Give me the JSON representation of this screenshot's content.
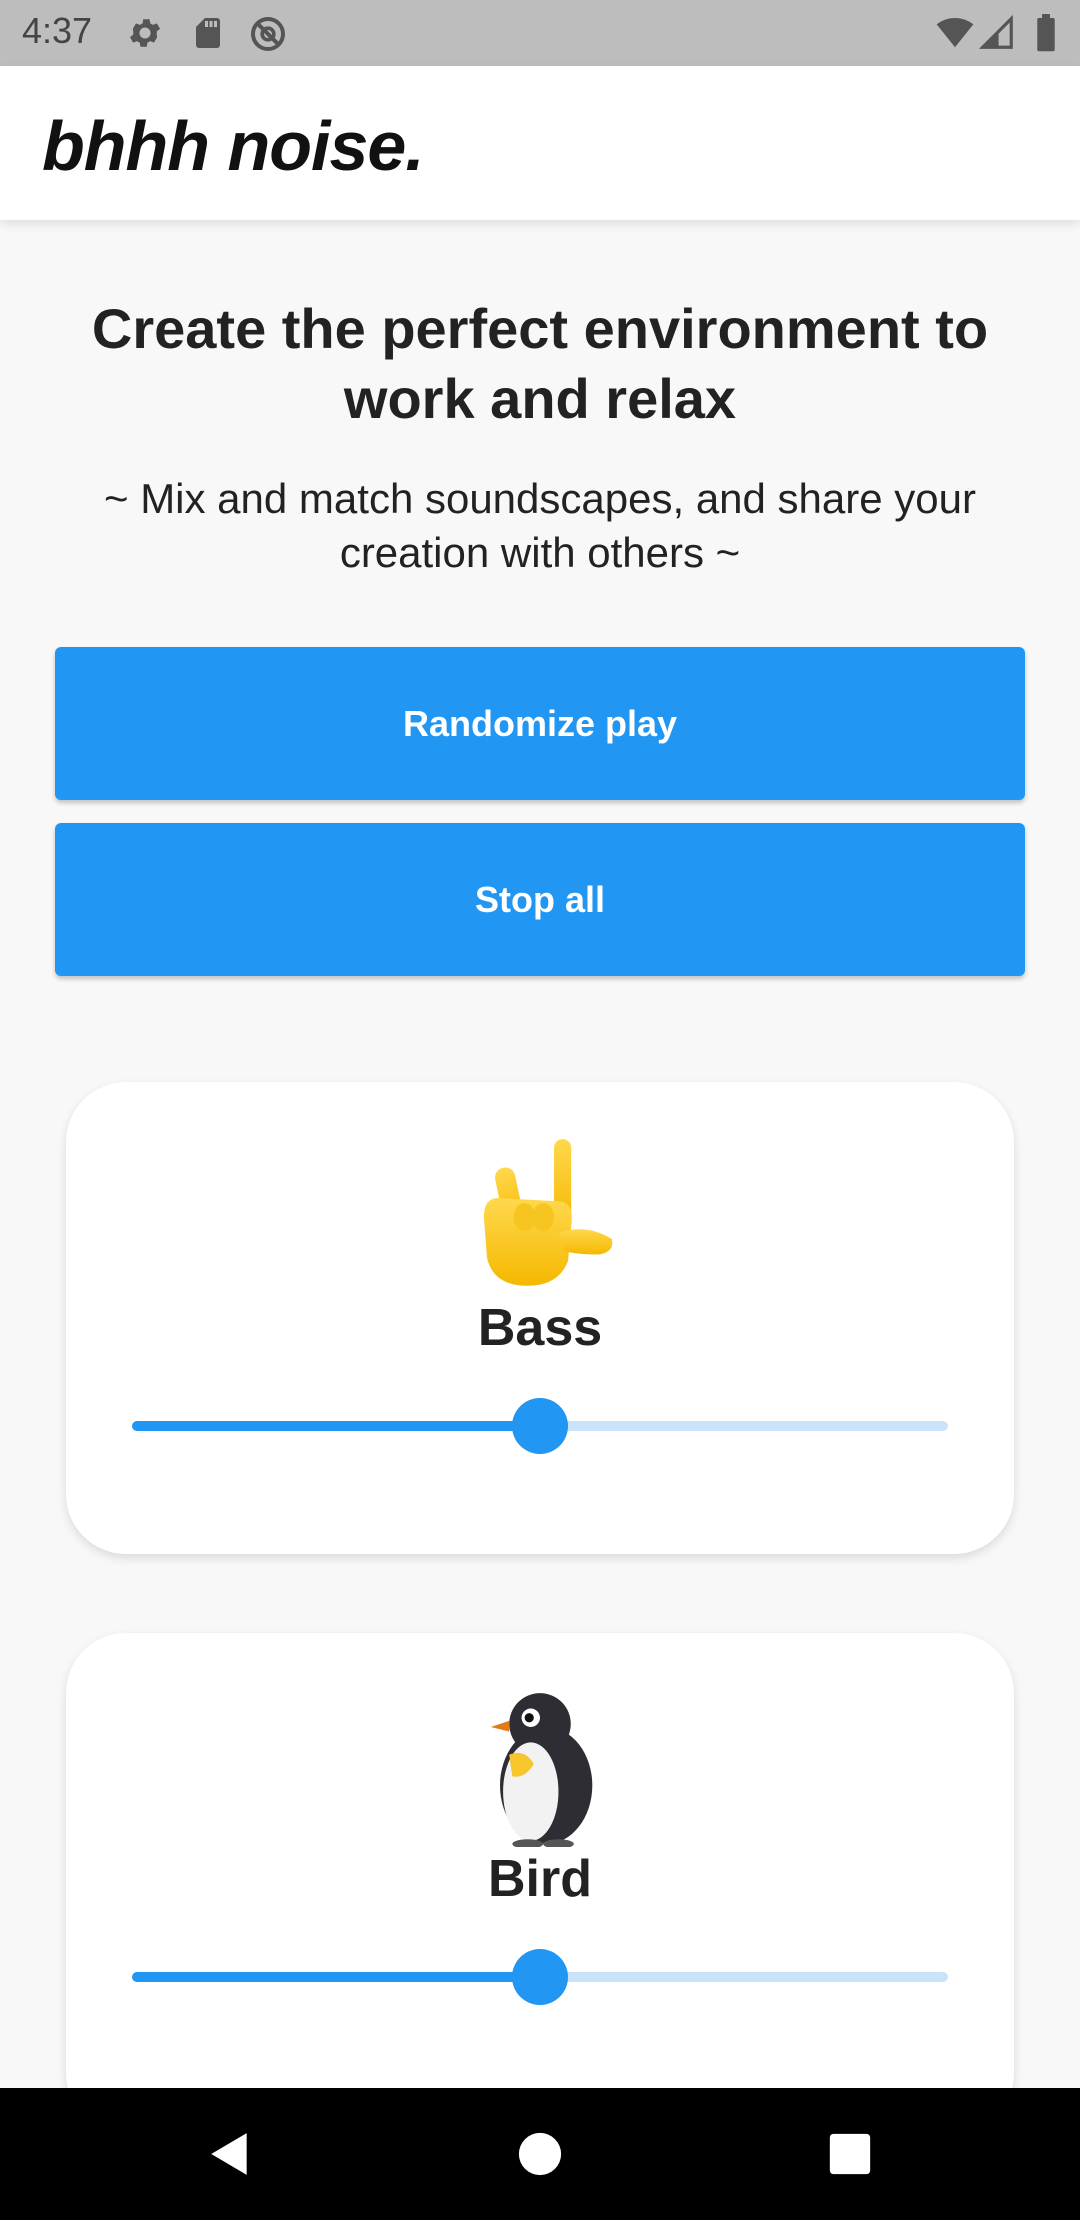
{
  "status_bar": {
    "time": "4:37",
    "left_icons": [
      "gear-icon",
      "sd-card-icon",
      "no-sync-icon"
    ],
    "right_icons": [
      "wifi-icon",
      "signal-icon",
      "battery-icon"
    ]
  },
  "app_bar": {
    "title": "bhhh noise."
  },
  "hero": {
    "headline": "Create the perfect environment to work and relax",
    "subhead": "~ Mix and match soundscapes, and share your creation with others ~"
  },
  "actions": {
    "randomize_label": "Randomize play",
    "stop_label": "Stop all"
  },
  "sounds": [
    {
      "name": "Bass",
      "icon": "rock-hand-icon",
      "volume": 0.5
    },
    {
      "name": "Bird",
      "icon": "penguin-icon",
      "volume": 0.5
    }
  ],
  "colors": {
    "accent": "#2196f3",
    "track": "#c9e3fb",
    "status_bar": "#bdbdbd"
  },
  "nav_bar": {
    "buttons": [
      "back-icon",
      "home-icon",
      "recents-icon"
    ]
  }
}
